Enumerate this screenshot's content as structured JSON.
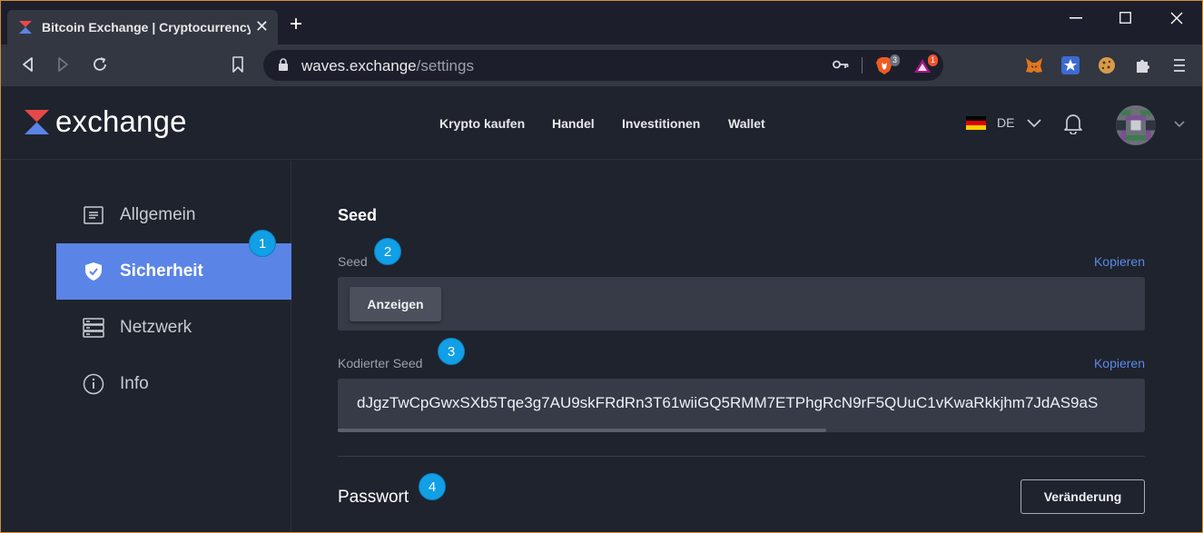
{
  "browser": {
    "tab_title": "Bitcoin Exchange | Cryptocurrency Exchange",
    "tab_close": "✕",
    "newtab": "+",
    "url_host": "waves.exchange",
    "url_path": "/settings",
    "brave_count": "3",
    "rewards_count": "1"
  },
  "app": {
    "logo_text": "exchange",
    "nav": [
      "Krypto kaufen",
      "Handel",
      "Investitionen",
      "Wallet"
    ],
    "lang": "DE"
  },
  "sidebar": {
    "items": [
      {
        "label": "Allgemein",
        "icon": "document-icon"
      },
      {
        "label": "Sicherheit",
        "icon": "shield-icon"
      },
      {
        "label": "Netzwerk",
        "icon": "server-icon"
      },
      {
        "label": "Info",
        "icon": "info-icon"
      }
    ],
    "active_index": 1
  },
  "main": {
    "seed_section_title": "Seed",
    "seed_label": "Seed",
    "copy_label": "Kopieren",
    "show_button": "Anzeigen",
    "encoded_label": "Kodierter Seed",
    "encoded_seed": "dJgzTwCpGwxSXb5Tqe3g7AU9skFRdRn3T61wiiGQ5RMM7ETPhgRcN9rF5QUuC1vKwaRkkjhm7JdAS9aS",
    "password_title": "Passwort",
    "change_button": "Veränderung"
  },
  "callouts": [
    "1",
    "2",
    "3",
    "4"
  ],
  "colors": {
    "accent": "#5a84e6",
    "callout": "#119fe6",
    "link": "#5a8ae6"
  }
}
